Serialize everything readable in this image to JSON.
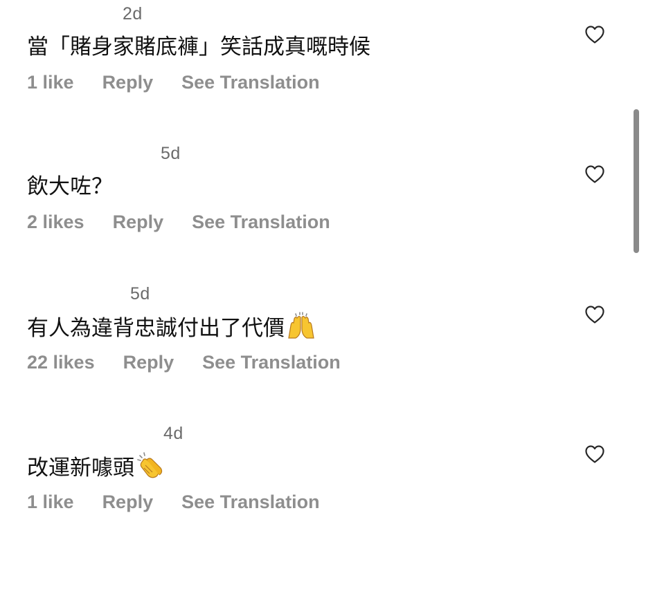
{
  "comments": [
    {
      "time": "2d",
      "text": "當「賭身家賭底褲」笑話成真嘅時候",
      "likes": "1 like",
      "reply": "Reply",
      "translate": "See Translation"
    },
    {
      "time": "5d",
      "text": "飲大咗？",
      "likes": "2 likes",
      "reply": "Reply",
      "translate": "See Translation"
    },
    {
      "time": "5d",
      "text": "有人為違背忠誠付出了代價",
      "emoji": "raising-hands-emoji",
      "likes": "22 likes",
      "reply": "Reply",
      "translate": "See Translation"
    },
    {
      "time": "4d",
      "text": "改運新噱頭",
      "emoji": "clapping-hands-emoji",
      "likes": "1 like",
      "reply": "Reply",
      "translate": "See Translation"
    }
  ],
  "icons": {
    "like": "heart-outline-icon"
  },
  "colors": {
    "meta_text": "#8e8e8e",
    "timestamp": "#6b6b6b",
    "emoji_yellow": "#f7c530"
  }
}
